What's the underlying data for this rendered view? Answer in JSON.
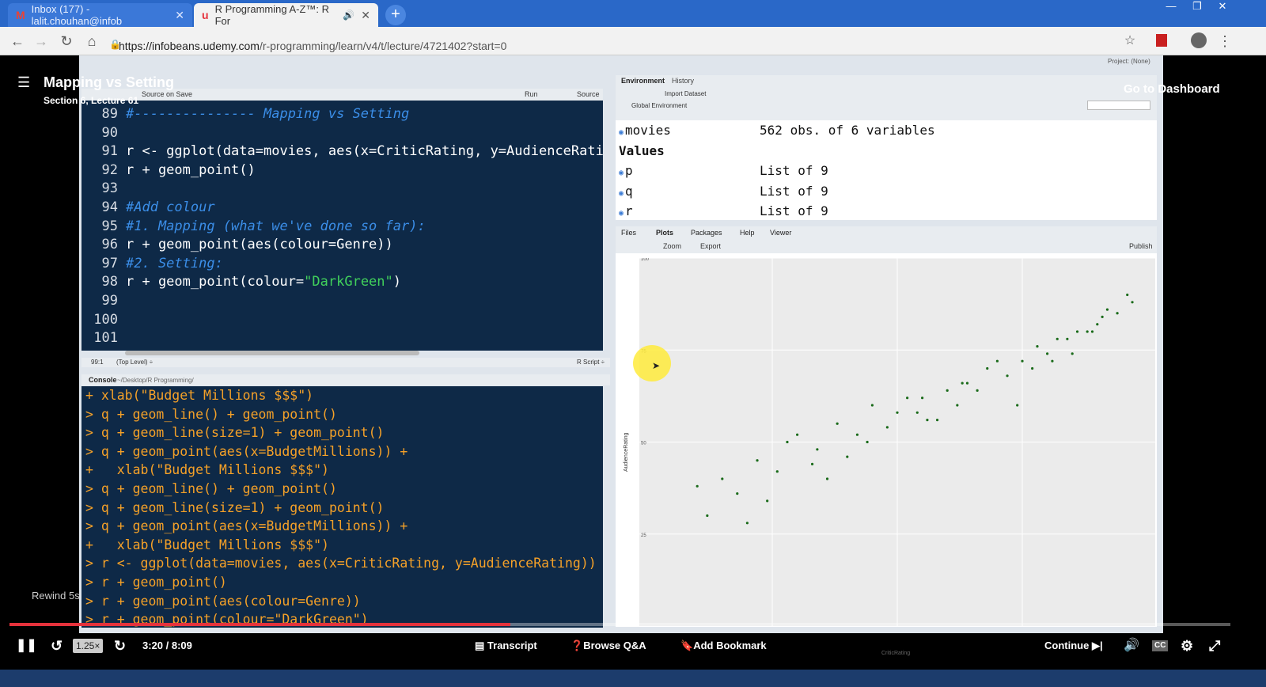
{
  "browser": {
    "tabs": [
      {
        "icon": "M",
        "label": "Inbox (177) - lalit.chouhan@infob"
      },
      {
        "icon": "u",
        "label": "R Programming A-Z™: R For"
      }
    ],
    "url_prefix": "https://infobeans.udemy.com",
    "url_path": "/r-programming/learn/v4/t/lecture/4721402?start=0",
    "new_tab": "+"
  },
  "lecture": {
    "title": "Mapping vs Setting",
    "subtitle": "Section 6, Lecture 61",
    "dashboard_link": "Go to Dashboard",
    "rewind_label": "Rewind 5s"
  },
  "rstudio": {
    "editor_toolbar": {
      "source_on_save": "Source on Save",
      "run": "Run",
      "source": "Source"
    },
    "editor_lines": [
      {
        "n": "89",
        "segs": [
          {
            "k": "c",
            "t": "#--------------- Mapping vs Setting"
          }
        ]
      },
      {
        "n": "90",
        "segs": []
      },
      {
        "n": "91",
        "segs": [
          {
            "k": "t",
            "t": "r <- ggplot(data=movies, aes(x=CriticRating, y=AudienceRating"
          }
        ]
      },
      {
        "n": "92",
        "segs": [
          {
            "k": "t",
            "t": "r + geom_point()"
          }
        ]
      },
      {
        "n": "93",
        "segs": []
      },
      {
        "n": "94",
        "segs": [
          {
            "k": "c",
            "t": "#Add colour"
          }
        ]
      },
      {
        "n": "95",
        "segs": [
          {
            "k": "c",
            "t": "#1. Mapping (what we've done so far):"
          }
        ]
      },
      {
        "n": "96",
        "segs": [
          {
            "k": "t",
            "t": "r + geom_point(aes(colour=Genre))"
          }
        ]
      },
      {
        "n": "97",
        "segs": [
          {
            "k": "c",
            "t": "#2. Setting:"
          }
        ]
      },
      {
        "n": "98",
        "segs": [
          {
            "k": "t",
            "t": "r + geom_point(colour="
          },
          {
            "k": "s",
            "t": "\"DarkGreen\""
          },
          {
            "k": "t",
            "t": ")"
          }
        ]
      },
      {
        "n": "99",
        "segs": []
      },
      {
        "n": "100",
        "segs": []
      },
      {
        "n": "101",
        "segs": []
      }
    ],
    "editor_status": {
      "pos": "99:1",
      "level": "(Top Level) ÷",
      "type": "R Script ÷"
    },
    "console_title": "Console",
    "console_path": "~/Desktop/R Programming/",
    "console_lines": [
      "+ xlab(\"Budget Millions $$$\")",
      "> q + geom_line() + geom_point()",
      "> q + geom_line(size=1) + geom_point()",
      "> q + geom_point(aes(x=BudgetMillions)) +",
      "+   xlab(\"Budget Millions $$$\")",
      "> q + geom_line() + geom_point()",
      "> q + geom_line(size=1) + geom_point()",
      "> q + geom_point(aes(x=BudgetMillions)) +",
      "+   xlab(\"Budget Millions $$$\")",
      "> r <- ggplot(data=movies, aes(x=CriticRating, y=AudienceRating))",
      "> r + geom_point()",
      "> r + geom_point(aes(colour=Genre))",
      "> r + geom_point(colour=\"DarkGreen\")"
    ],
    "env_tabs": [
      "Environment",
      "History"
    ],
    "env_toolbar": {
      "import": "Import Dataset",
      "scope": "Global Environment"
    },
    "env_rows": [
      {
        "name": "movies",
        "value": "562 obs. of 6 variables"
      },
      {
        "header": "Values"
      },
      {
        "name": "p",
        "value": "List of 9"
      },
      {
        "name": "q",
        "value": "List of 9"
      },
      {
        "name": "r",
        "value": "List of 9"
      }
    ],
    "files_tabs": [
      "Files",
      "Plots",
      "Packages",
      "Help",
      "Viewer"
    ],
    "plot_toolbar": {
      "zoom": "Zoom",
      "export": "Export",
      "publish": "Publish"
    },
    "project": "Project: (None)"
  },
  "chart_data": {
    "type": "scatter",
    "xlabel": "CriticRating",
    "ylabel": "AudienceRating",
    "ylim": [
      0,
      100
    ],
    "xlim": [
      0,
      100
    ],
    "y_ticks": [
      "100",
      "75",
      "50",
      "25"
    ],
    "point_color": "#1a6b1a",
    "points_note": "562 points, positive correlation",
    "x": [
      15,
      22,
      30,
      38,
      45,
      52,
      60,
      68,
      75,
      82,
      90,
      97,
      12,
      26,
      34,
      48,
      56,
      64,
      72,
      80,
      88,
      94,
      18,
      28,
      40,
      50,
      62,
      70,
      78,
      86,
      92,
      20,
      33,
      44,
      55,
      66,
      77,
      84,
      96,
      24,
      36,
      58,
      74,
      85,
      91,
      10,
      42,
      54,
      63,
      81,
      89
    ],
    "y": [
      40,
      45,
      52,
      55,
      60,
      62,
      64,
      70,
      72,
      78,
      82,
      88,
      30,
      42,
      48,
      54,
      56,
      66,
      68,
      74,
      80,
      85,
      36,
      50,
      46,
      58,
      60,
      72,
      76,
      80,
      86,
      28,
      44,
      50,
      62,
      64,
      70,
      78,
      90,
      34,
      40,
      56,
      60,
      74,
      84,
      38,
      52,
      58,
      66,
      72,
      80
    ]
  },
  "player": {
    "time": "3:20 / 8:09",
    "speed": "1.25×",
    "progress": 0.41,
    "transcript": "Transcript",
    "browse": "Browse Q&A",
    "bookmark": "Add Bookmark",
    "continue": "Continue"
  },
  "colors": {
    "accent_red": "#e5323c",
    "editor_bg": "#0e2947",
    "console_text": "#f5a128"
  }
}
